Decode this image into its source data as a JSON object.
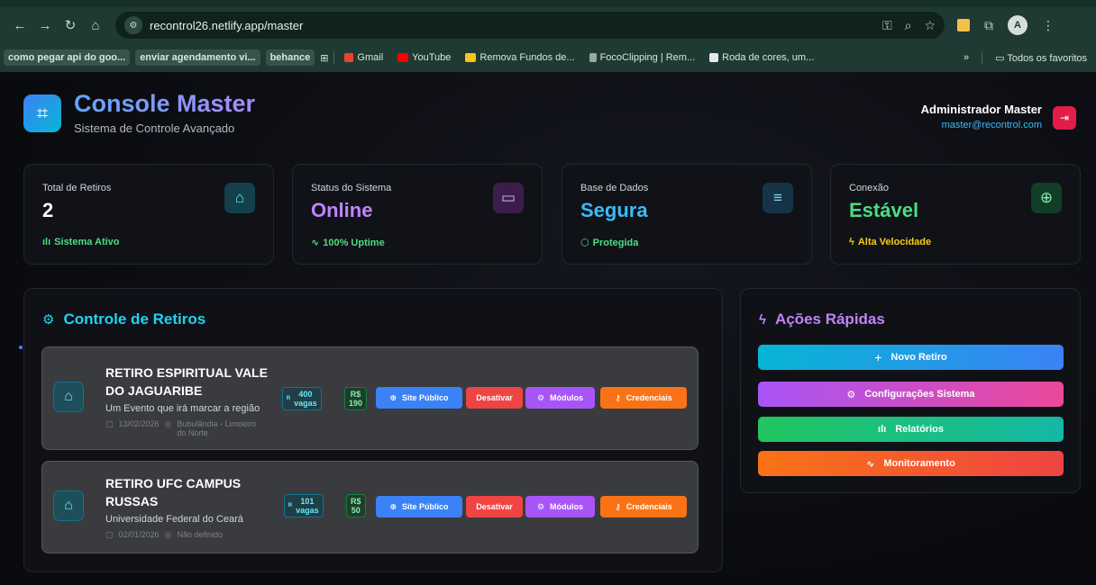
{
  "browser": {
    "url": "recontrol26.netlify.app/master",
    "bookmarks": [
      {
        "label": "como pegar api do goo...",
        "chip": true
      },
      {
        "label": "enviar agendamento vi...",
        "chip": true
      },
      {
        "label": "behance",
        "chip": true
      },
      {
        "label": "Gmail",
        "color": "#ea4335"
      },
      {
        "label": "YouTube",
        "color": "#ff0000"
      },
      {
        "label": "Remova Fundos de...",
        "color": "#f5c518"
      },
      {
        "label": "FocoClipping | Rem...",
        "color": "#9aa8a3"
      },
      {
        "label": "Roda de cores, um...",
        "color": "#e5e7eb"
      }
    ],
    "all_bookmarks": "Todos os favoritos",
    "more": "»"
  },
  "header": {
    "title": "Console Master",
    "subtitle": "Sistema de Controle Avançado",
    "user_name": "Administrador Master",
    "user_email": "master@recontrol.com"
  },
  "stats": [
    {
      "label": "Total de Retiros",
      "value": "2",
      "foot": "Sistema Ativo",
      "color": "#38bdf8",
      "foot_color": "#4ade80",
      "icon": "building-icon",
      "icon_bg": "#13404a"
    },
    {
      "label": "Status do Sistema",
      "value": "Online",
      "foot": "100% Uptime",
      "color": "#c084fc",
      "foot_color": "#4ade80",
      "icon": "monitor-icon",
      "icon_bg": "#3b1d4a"
    },
    {
      "label": "Base de Dados",
      "value": "Segura",
      "foot": "Protegida",
      "color": "#38bdf8",
      "foot_color": "#4ade80",
      "icon": "database-icon",
      "icon_bg": "#163447"
    },
    {
      "label": "Conexão",
      "value": "Estável",
      "foot": "Alta Velocidade",
      "color": "#4ade80",
      "foot_color": "#facc15",
      "icon": "globe-icon",
      "icon_bg": "#123d27"
    }
  ],
  "retiros_panel": {
    "title": "Controle de Retiros",
    "items": [
      {
        "name": "RETIRO ESPIRITUAL VALE DO JAGUARIBE",
        "description": "Um Evento que irá marcar a região",
        "date": "13/02/2026",
        "location": "Bubulândia - Limoeiro do Norte",
        "vagas": "400",
        "vagas_label": "vagas",
        "price_currency": "R$",
        "price": "190"
      },
      {
        "name": "RETIRO UFC CAMPUS RUSSAS",
        "description": "Universidade Federal do Ceará",
        "date": "02/01/2026",
        "location": "Não definido",
        "vagas": "101",
        "vagas_label": "vagas",
        "price_currency": "R$",
        "price": "50"
      }
    ],
    "actions": {
      "site": "Site Público",
      "disable": "Desativar",
      "modules": "Módulos",
      "credentials": "Credenciais"
    }
  },
  "quick_actions": {
    "title": "Ações Rápidas",
    "items": [
      {
        "label": "Novo Retiro",
        "icon": "plus-icon"
      },
      {
        "label": "Configurações Sistema",
        "icon": "gear-icon"
      },
      {
        "label": "Relatórios",
        "icon": "bar-chart-icon"
      },
      {
        "label": "Monitoramento",
        "icon": "activity-icon"
      }
    ]
  },
  "colors": {
    "site_btn": "#3b82f6",
    "disable_btn": "#ef4444",
    "modules_btn": "#a855f7",
    "credentials_btn": "#f97316"
  }
}
